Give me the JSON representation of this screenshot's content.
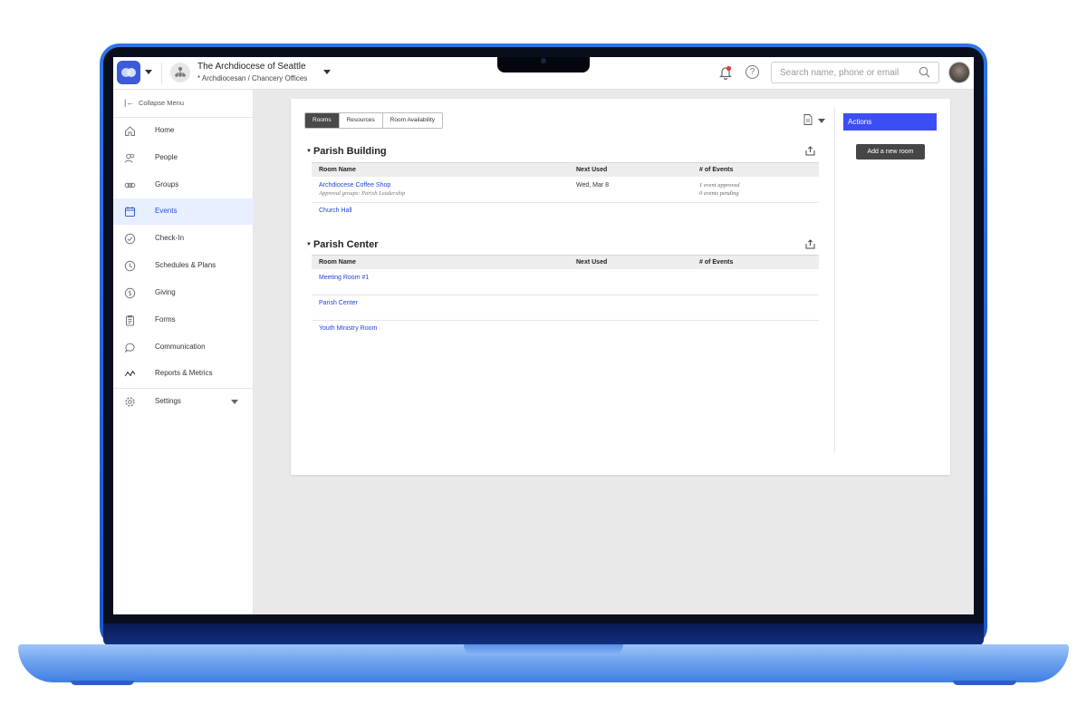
{
  "header": {
    "org_title": "The Archdiocese of Seattle",
    "org_subtitle": "* Archdiocesan / Chancery Offices",
    "search_placeholder": "Search name, phone or email"
  },
  "sidebar": {
    "collapse_label": "Collapse Menu",
    "items": [
      {
        "label": "Home",
        "icon": "home-icon"
      },
      {
        "label": "People",
        "icon": "people-icon"
      },
      {
        "label": "Groups",
        "icon": "groups-icon"
      },
      {
        "label": "Events",
        "icon": "calendar-icon",
        "active": true
      },
      {
        "label": "Check-In",
        "icon": "check-circle-icon"
      },
      {
        "label": "Schedules & Plans",
        "icon": "clock-icon"
      },
      {
        "label": "Giving",
        "icon": "dollar-icon"
      },
      {
        "label": "Forms",
        "icon": "clipboard-icon"
      },
      {
        "label": "Communication",
        "icon": "chat-icon"
      },
      {
        "label": "Reports & Metrics",
        "icon": "chart-line-icon"
      },
      {
        "label": "Settings",
        "icon": "gear-icon"
      }
    ]
  },
  "tabs": [
    "Rooms",
    "Resources",
    "Room Availability"
  ],
  "columns": {
    "name": "Room Name",
    "next": "Next Used",
    "events": "# of Events"
  },
  "sections": [
    {
      "title": "Parish Building",
      "rows": [
        {
          "name": "Archdiocese Coffee Shop",
          "sub": "Approval groups: Parish Leadership",
          "next": "Wed, Mar 8",
          "events_a": "1 event approved",
          "events_b": "0 events pending"
        },
        {
          "name": "Church Hall",
          "sub": "",
          "next": "",
          "events_a": "",
          "events_b": ""
        }
      ]
    },
    {
      "title": "Parish Center",
      "rows": [
        {
          "name": "Meeting Room #1"
        },
        {
          "name": "Parish Center"
        },
        {
          "name": "Youth Ministry Room"
        }
      ]
    }
  ],
  "actions": {
    "title": "Actions",
    "add_room": "Add a new room"
  },
  "colors": {
    "accent": "#3b4ef5",
    "link": "#2344d9",
    "active_nav_bg": "#e8efff",
    "laptop": "#2f74e6"
  }
}
